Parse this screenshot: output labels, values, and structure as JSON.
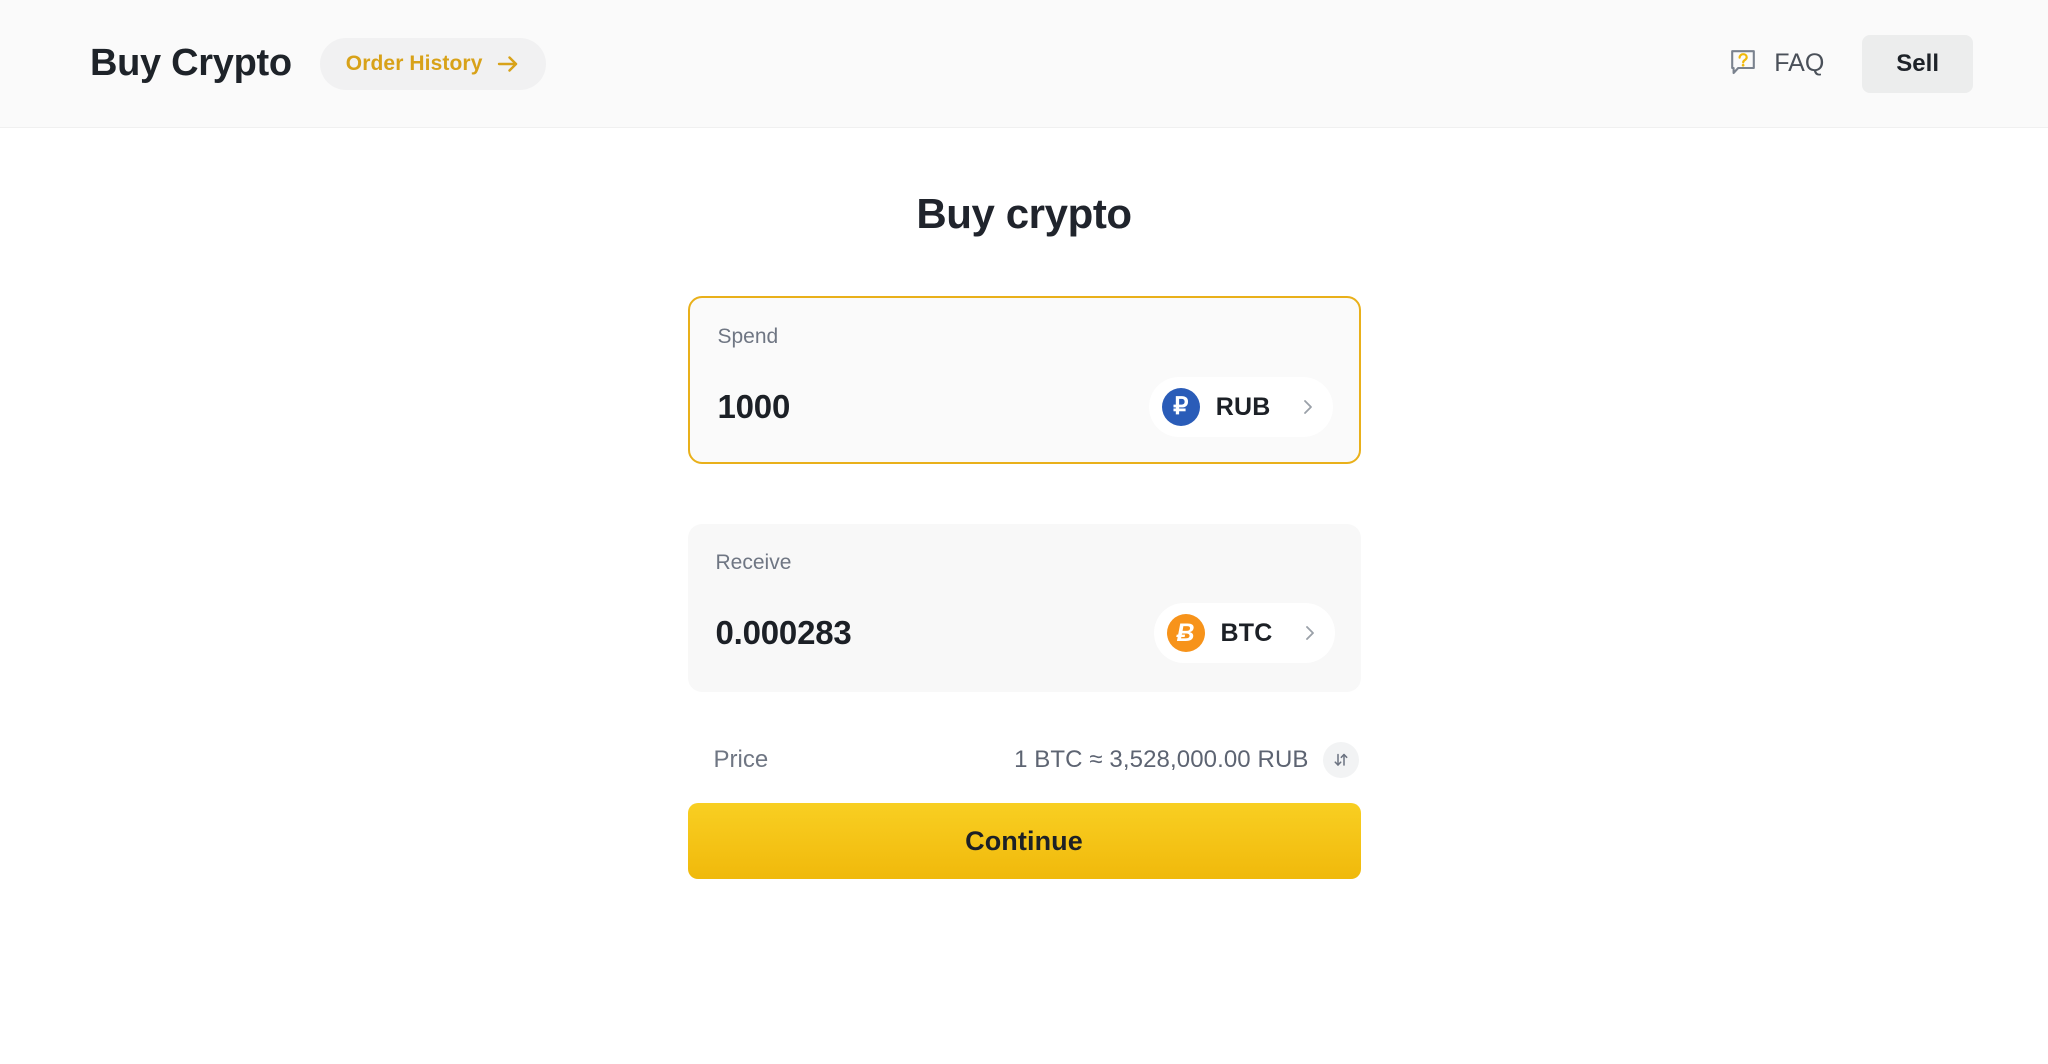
{
  "header": {
    "brand_title": "Buy Crypto",
    "order_history": {
      "label": "Order History",
      "icon": "arrow-right-icon"
    },
    "faq": {
      "label": "FAQ",
      "icon": "question-bubble-icon"
    },
    "sell_button": {
      "label": "Sell"
    }
  },
  "main": {
    "page_title": "Buy crypto",
    "spend": {
      "label": "Spend",
      "amount": "1000",
      "placeholder": "0",
      "currency": {
        "code": "RUB",
        "symbol": "₽",
        "color": "#2a5cb8"
      }
    },
    "receive": {
      "label": "Receive",
      "amount": "0.000283",
      "placeholder": "0",
      "currency": {
        "code": "BTC",
        "symbol": "Ƀ",
        "color": "#f7931a"
      }
    },
    "price": {
      "label": "Price",
      "value": "1 BTC ≈ 3,528,000.00 RUB",
      "swap_icon": "swap-vertical-icon"
    },
    "continue_button": {
      "label": "Continue"
    }
  },
  "colors": {
    "accent": "#f0b90b",
    "accent_text": "#d8a219",
    "focus_border": "#e9b01a",
    "header_bg": "#fafafa",
    "card_bg": "#f8f8f8",
    "text_primary": "#1c2026",
    "text_muted": "#6f7683"
  }
}
